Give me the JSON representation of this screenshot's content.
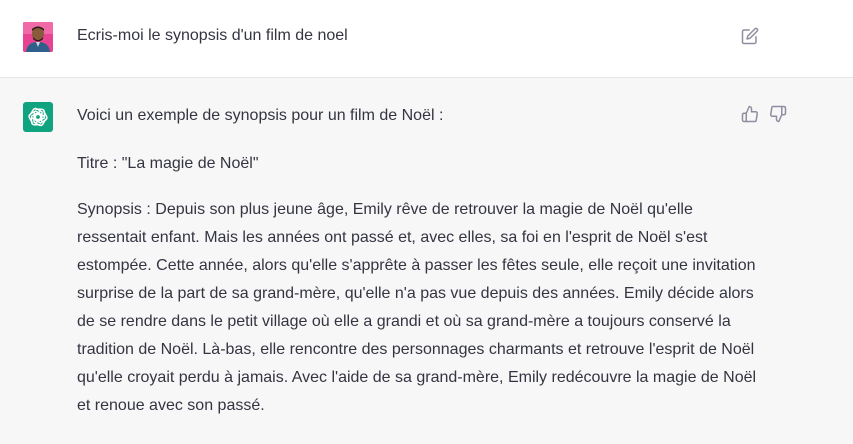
{
  "user_message": {
    "avatar": "user-photo-avatar",
    "text": "Ecris-moi le synopsis d'un film de noel",
    "edit_icon": "edit-icon"
  },
  "assistant_message": {
    "avatar": "openai-logo-icon",
    "intro": "Voici un exemple de synopsis pour un film de Noël :",
    "title_line": "Titre : \"La magie de Noël\"",
    "synopsis": "Synopsis : Depuis son plus jeune âge, Emily rêve de retrouver la magie de Noël qu'elle ressentait enfant. Mais les années ont passé et, avec elles, sa foi en l'esprit de Noël s'est estompée. Cette année, alors qu'elle s'apprête à passer les fêtes seule, elle reçoit une invitation surprise de la part de sa grand-mère, qu'elle n'a pas vue depuis des années. Emily décide alors de se rendre dans le petit village où elle a grandi et où sa grand-mère a toujours conservé la tradition de Noël. Là-bas, elle rencontre des personnages charmants et retrouve l'esprit de Noël qu'elle croyait perdu à jamais. Avec l'aide de sa grand-mère, Emily redécouvre la magie de Noël et renoue avec son passé.",
    "feedback_icons": [
      "thumbs-up-icon",
      "thumbs-down-icon"
    ]
  },
  "colors": {
    "user_row_bg": "#ffffff",
    "assistant_row_bg": "#f7f7f8",
    "bot_avatar": "#10a37f",
    "user_avatar_bg": "#e84393",
    "text": "#343541",
    "icon": "#8e8ea0"
  }
}
